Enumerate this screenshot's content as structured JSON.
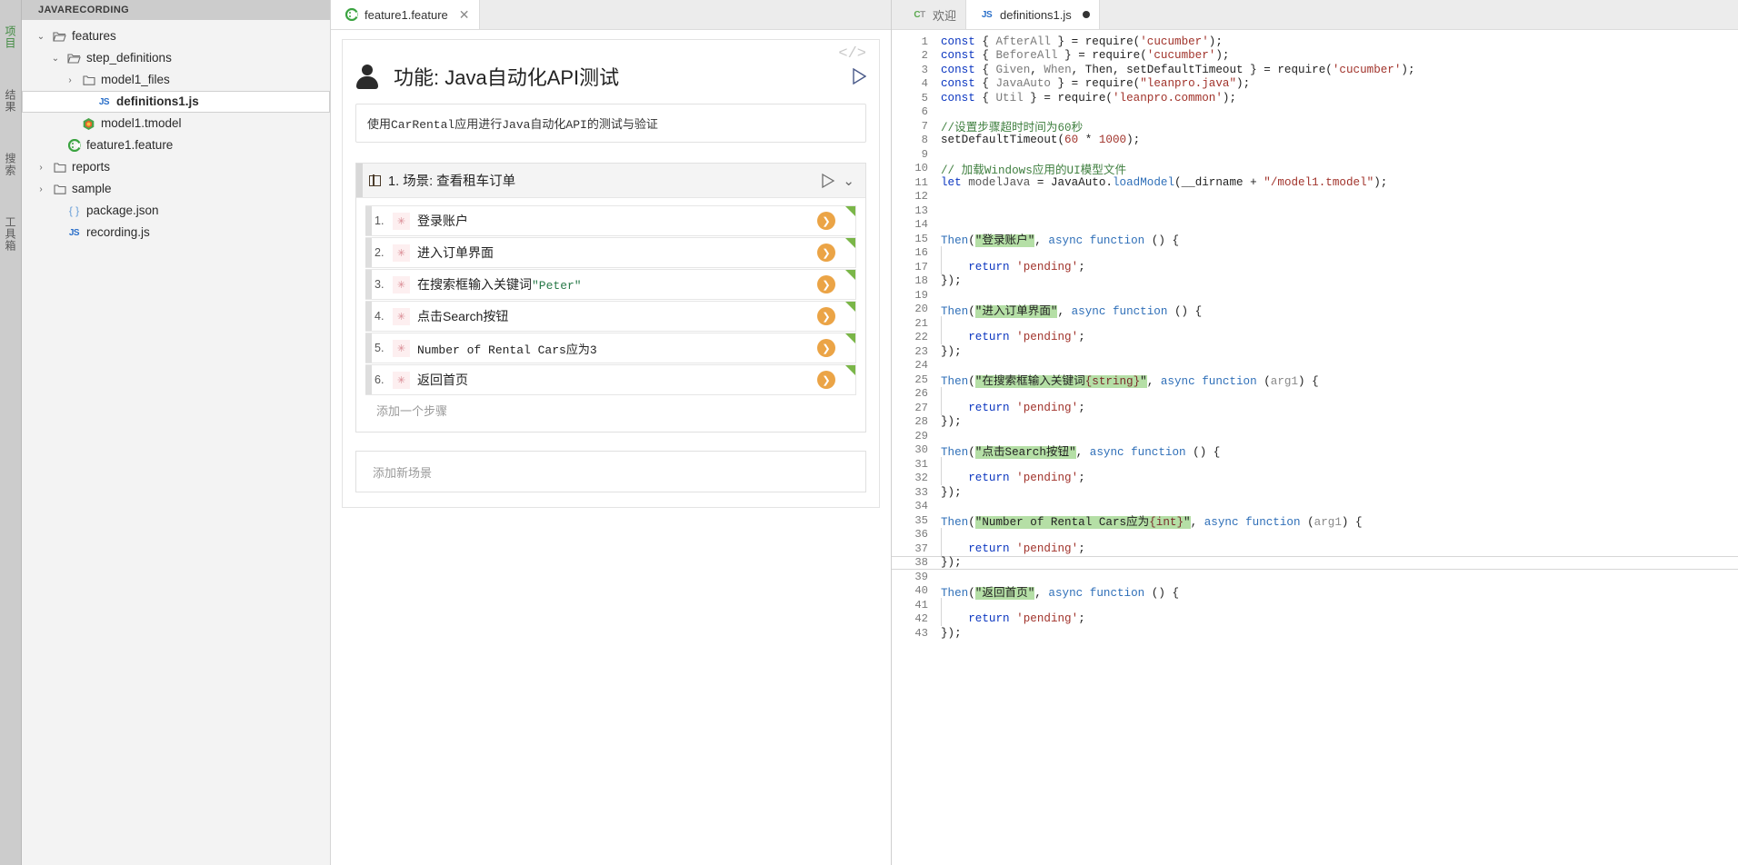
{
  "activitybar": {
    "items": [
      {
        "label": "项目",
        "name": "project",
        "active": true
      },
      {
        "label": "结果",
        "name": "results",
        "active": false
      },
      {
        "label": "搜索",
        "name": "search",
        "active": false
      },
      {
        "label": "工具箱",
        "name": "toolbox",
        "active": false
      }
    ]
  },
  "explorer": {
    "title": "JAVARECORDING",
    "tree": [
      {
        "label": "features",
        "icon": "folder-open-icon",
        "chevron": "⌄",
        "indent": 0,
        "selected": false
      },
      {
        "label": "step_definitions",
        "icon": "folder-open-icon",
        "chevron": "⌄",
        "indent": 1,
        "selected": false
      },
      {
        "label": "model1_files",
        "icon": "folder-icon",
        "chevron": "›",
        "indent": 2,
        "selected": false
      },
      {
        "label": "definitions1.js",
        "icon": "js-icon",
        "chevron": "",
        "indent": 3,
        "selected": true
      },
      {
        "label": "model1.tmodel",
        "icon": "tmodel-icon",
        "chevron": "",
        "indent": 2,
        "selected": false
      },
      {
        "label": "feature1.feature",
        "icon": "cucumber-icon",
        "chevron": "",
        "indent": 1,
        "selected": false
      },
      {
        "label": "reports",
        "icon": "folder-icon",
        "chevron": "›",
        "indent": 0,
        "selected": false
      },
      {
        "label": "sample",
        "icon": "folder-icon",
        "chevron": "›",
        "indent": 0,
        "selected": false
      },
      {
        "label": "package.json",
        "icon": "json-icon",
        "chevron": "",
        "indent": 1,
        "selected": false
      },
      {
        "label": "recording.js",
        "icon": "js-icon",
        "chevron": "",
        "indent": 1,
        "selected": false
      }
    ]
  },
  "center": {
    "tabs": [
      {
        "label": "feature1.feature",
        "icon": "cucumber-icon",
        "active": true,
        "close": "✕"
      }
    ],
    "code_toggle": "</>",
    "feature_title": "功能: Java自动化API测试",
    "feature_description": "使用CarRental应用进行Java自动化API的测试与验证",
    "scenario": {
      "title": "1. 场景: 查看租车订单",
      "collapse_icon": "⌄",
      "steps": [
        {
          "num": "1.",
          "star": "✳",
          "text": "登录账户",
          "suffix": "",
          "suffix_kind": ""
        },
        {
          "num": "2.",
          "star": "✳",
          "text": "进入订单界面",
          "suffix": "",
          "suffix_kind": ""
        },
        {
          "num": "3.",
          "star": "✳",
          "text": "在搜索框输入关键词",
          "suffix": "\"Peter\"",
          "suffix_kind": "quoted"
        },
        {
          "num": "4.",
          "star": "✳",
          "text": "点击Search按钮",
          "suffix": "",
          "suffix_kind": ""
        },
        {
          "num": "5.",
          "star": "✳",
          "text": "Number of Rental Cars应为3",
          "suffix": "",
          "suffix_kind": "mono"
        },
        {
          "num": "6.",
          "star": "✳",
          "text": "返回首页",
          "suffix": "",
          "suffix_kind": ""
        }
      ],
      "play_glyph": "❯"
    },
    "add_step_label": "添加一个步骤",
    "add_scenario_label": "添加新场景"
  },
  "right": {
    "tabs": [
      {
        "label": "欢迎",
        "icon": "ct-icon",
        "active": false,
        "dirty": false
      },
      {
        "label": "definitions1.js",
        "icon": "js-icon",
        "active": true,
        "dirty": true
      }
    ],
    "code": [
      {
        "n": 1,
        "tokens": [
          {
            "t": "const ",
            "c": "kw"
          },
          {
            "t": "{ ",
            "c": "tok"
          },
          {
            "t": "AfterAll",
            "c": "kwp"
          },
          {
            "t": " } = ",
            "c": "tok"
          },
          {
            "t": "require",
            "c": "tok"
          },
          {
            "t": "(",
            "c": "tok"
          },
          {
            "t": "'cucumber'",
            "c": "str"
          },
          {
            "t": ");",
            "c": "tok"
          }
        ]
      },
      {
        "n": 2,
        "tokens": [
          {
            "t": "const ",
            "c": "kw"
          },
          {
            "t": "{ ",
            "c": "tok"
          },
          {
            "t": "BeforeAll",
            "c": "kwp"
          },
          {
            "t": " } = ",
            "c": "tok"
          },
          {
            "t": "require",
            "c": "tok"
          },
          {
            "t": "(",
            "c": "tok"
          },
          {
            "t": "'cucumber'",
            "c": "str"
          },
          {
            "t": ");",
            "c": "tok"
          }
        ]
      },
      {
        "n": 3,
        "tokens": [
          {
            "t": "const ",
            "c": "kw"
          },
          {
            "t": "{ ",
            "c": "tok"
          },
          {
            "t": "Given",
            "c": "kwp"
          },
          {
            "t": ", ",
            "c": "tok"
          },
          {
            "t": "When",
            "c": "kwp"
          },
          {
            "t": ", Then, setDefaultTimeout } = ",
            "c": "tok"
          },
          {
            "t": "require",
            "c": "tok"
          },
          {
            "t": "(",
            "c": "tok"
          },
          {
            "t": "'cucumber'",
            "c": "str"
          },
          {
            "t": ");",
            "c": "tok"
          }
        ]
      },
      {
        "n": 4,
        "tokens": [
          {
            "t": "const ",
            "c": "kw"
          },
          {
            "t": "{ ",
            "c": "tok"
          },
          {
            "t": "JavaAuto",
            "c": "kwp"
          },
          {
            "t": " } = ",
            "c": "tok"
          },
          {
            "t": "require",
            "c": "tok"
          },
          {
            "t": "(",
            "c": "tok"
          },
          {
            "t": "\"leanpro.java\"",
            "c": "str"
          },
          {
            "t": ");",
            "c": "tok"
          }
        ]
      },
      {
        "n": 5,
        "tokens": [
          {
            "t": "const ",
            "c": "kw"
          },
          {
            "t": "{ ",
            "c": "tok"
          },
          {
            "t": "Util",
            "c": "kwp"
          },
          {
            "t": " } = ",
            "c": "tok"
          },
          {
            "t": "require",
            "c": "tok"
          },
          {
            "t": "(",
            "c": "tok"
          },
          {
            "t": "'leanpro.common'",
            "c": "str"
          },
          {
            "t": ");",
            "c": "tok"
          }
        ]
      },
      {
        "n": 6,
        "tokens": []
      },
      {
        "n": 7,
        "tokens": [
          {
            "t": "//设置步骤超时时间为60秒",
            "c": "cmt"
          }
        ]
      },
      {
        "n": 8,
        "tokens": [
          {
            "t": "setDefaultTimeout(",
            "c": "tok"
          },
          {
            "t": "60",
            "c": "str"
          },
          {
            "t": " * ",
            "c": "tok"
          },
          {
            "t": "1000",
            "c": "str"
          },
          {
            "t": ");",
            "c": "tok"
          }
        ]
      },
      {
        "n": 9,
        "tokens": []
      },
      {
        "n": 10,
        "tokens": [
          {
            "t": "// 加载Windows应用的UI模型文件",
            "c": "cmt"
          }
        ]
      },
      {
        "n": 11,
        "tokens": [
          {
            "t": "let ",
            "c": "kw"
          },
          {
            "t": "modelJava",
            "c": "id"
          },
          {
            "t": " = ",
            "c": "tok"
          },
          {
            "t": "JavaAuto",
            "c": "tok"
          },
          {
            "t": ".",
            "c": "tok"
          },
          {
            "t": "loadModel",
            "c": "fn"
          },
          {
            "t": "(__dirname + ",
            "c": "tok"
          },
          {
            "t": "\"/model1.tmodel\"",
            "c": "str"
          },
          {
            "t": ");",
            "c": "tok"
          }
        ]
      },
      {
        "n": 12,
        "tokens": []
      },
      {
        "n": 13,
        "tokens": []
      },
      {
        "n": 14,
        "tokens": []
      },
      {
        "n": 15,
        "tokens": [
          {
            "t": "Then",
            "c": "fn"
          },
          {
            "t": "(",
            "c": "tok"
          },
          {
            "t": "\"登录账户\"",
            "c": "hl"
          },
          {
            "t": ", ",
            "c": "tok"
          },
          {
            "t": "async function",
            "c": "fn"
          },
          {
            "t": " () {",
            "c": "tok"
          }
        ]
      },
      {
        "n": 16,
        "tokens": [],
        "guide": true
      },
      {
        "n": 17,
        "tokens": [
          {
            "t": "    ",
            "c": "tok"
          },
          {
            "t": "return",
            "c": "kw"
          },
          {
            "t": " ",
            "c": "tok"
          },
          {
            "t": "'pending'",
            "c": "str"
          },
          {
            "t": ";",
            "c": "tok"
          }
        ],
        "guide": true
      },
      {
        "n": 18,
        "tokens": [
          {
            "t": "});",
            "c": "tok"
          }
        ]
      },
      {
        "n": 19,
        "tokens": []
      },
      {
        "n": 20,
        "tokens": [
          {
            "t": "Then",
            "c": "fn"
          },
          {
            "t": "(",
            "c": "tok"
          },
          {
            "t": "\"进入订单界面\"",
            "c": "hl"
          },
          {
            "t": ", ",
            "c": "tok"
          },
          {
            "t": "async function",
            "c": "fn"
          },
          {
            "t": " () {",
            "c": "tok"
          }
        ]
      },
      {
        "n": 21,
        "tokens": [],
        "guide": true
      },
      {
        "n": 22,
        "tokens": [
          {
            "t": "    ",
            "c": "tok"
          },
          {
            "t": "return",
            "c": "kw"
          },
          {
            "t": " ",
            "c": "tok"
          },
          {
            "t": "'pending'",
            "c": "str"
          },
          {
            "t": ";",
            "c": "tok"
          }
        ],
        "guide": true
      },
      {
        "n": 23,
        "tokens": [
          {
            "t": "});",
            "c": "tok"
          }
        ]
      },
      {
        "n": 24,
        "tokens": []
      },
      {
        "n": 25,
        "tokens": [
          {
            "t": "Then",
            "c": "fn"
          },
          {
            "t": "(",
            "c": "tok"
          },
          {
            "t": "\"在搜索框输入关键词",
            "c": "hl"
          },
          {
            "t": "{string}",
            "c": "hlp"
          },
          {
            "t": "\"",
            "c": "hl"
          },
          {
            "t": ", ",
            "c": "tok"
          },
          {
            "t": "async function",
            "c": "fn"
          },
          {
            "t": " (",
            "c": "tok"
          },
          {
            "t": "arg1",
            "c": "arg"
          },
          {
            "t": ") {",
            "c": "tok"
          }
        ]
      },
      {
        "n": 26,
        "tokens": [],
        "guide": true
      },
      {
        "n": 27,
        "tokens": [
          {
            "t": "    ",
            "c": "tok"
          },
          {
            "t": "return",
            "c": "kw"
          },
          {
            "t": " ",
            "c": "tok"
          },
          {
            "t": "'pending'",
            "c": "str"
          },
          {
            "t": ";",
            "c": "tok"
          }
        ],
        "guide": true
      },
      {
        "n": 28,
        "tokens": [
          {
            "t": "});",
            "c": "tok"
          }
        ]
      },
      {
        "n": 29,
        "tokens": []
      },
      {
        "n": 30,
        "tokens": [
          {
            "t": "Then",
            "c": "fn"
          },
          {
            "t": "(",
            "c": "tok"
          },
          {
            "t": "\"点击Search按钮\"",
            "c": "hl"
          },
          {
            "t": ", ",
            "c": "tok"
          },
          {
            "t": "async function",
            "c": "fn"
          },
          {
            "t": " () {",
            "c": "tok"
          }
        ]
      },
      {
        "n": 31,
        "tokens": [],
        "guide": true
      },
      {
        "n": 32,
        "tokens": [
          {
            "t": "    ",
            "c": "tok"
          },
          {
            "t": "return",
            "c": "kw"
          },
          {
            "t": " ",
            "c": "tok"
          },
          {
            "t": "'pending'",
            "c": "str"
          },
          {
            "t": ";",
            "c": "tok"
          }
        ],
        "guide": true
      },
      {
        "n": 33,
        "tokens": [
          {
            "t": "});",
            "c": "tok"
          }
        ]
      },
      {
        "n": 34,
        "tokens": []
      },
      {
        "n": 35,
        "tokens": [
          {
            "t": "Then",
            "c": "fn"
          },
          {
            "t": "(",
            "c": "tok"
          },
          {
            "t": "\"Number of Rental Cars应为",
            "c": "hl"
          },
          {
            "t": "{int}",
            "c": "hlp"
          },
          {
            "t": "\"",
            "c": "hl"
          },
          {
            "t": ", ",
            "c": "tok"
          },
          {
            "t": "async function",
            "c": "fn"
          },
          {
            "t": " (",
            "c": "tok"
          },
          {
            "t": "arg1",
            "c": "arg"
          },
          {
            "t": ") {",
            "c": "tok"
          }
        ]
      },
      {
        "n": 36,
        "tokens": [],
        "guide": true
      },
      {
        "n": 37,
        "tokens": [
          {
            "t": "    ",
            "c": "tok"
          },
          {
            "t": "return",
            "c": "kw"
          },
          {
            "t": " ",
            "c": "tok"
          },
          {
            "t": "'pending'",
            "c": "str"
          },
          {
            "t": ";",
            "c": "tok"
          }
        ],
        "guide": true
      },
      {
        "n": 38,
        "tokens": [
          {
            "t": "});",
            "c": "tok"
          }
        ],
        "cursor": true
      },
      {
        "n": 39,
        "tokens": []
      },
      {
        "n": 40,
        "tokens": [
          {
            "t": "Then",
            "c": "fn"
          },
          {
            "t": "(",
            "c": "tok"
          },
          {
            "t": "\"返回首页\"",
            "c": "hl"
          },
          {
            "t": ", ",
            "c": "tok"
          },
          {
            "t": "async function",
            "c": "fn"
          },
          {
            "t": " () {",
            "c": "tok"
          }
        ]
      },
      {
        "n": 41,
        "tokens": [],
        "guide": true
      },
      {
        "n": 42,
        "tokens": [
          {
            "t": "    ",
            "c": "tok"
          },
          {
            "t": "return",
            "c": "kw"
          },
          {
            "t": " ",
            "c": "tok"
          },
          {
            "t": "'pending'",
            "c": "str"
          },
          {
            "t": ";",
            "c": "tok"
          }
        ],
        "guide": true
      },
      {
        "n": 43,
        "tokens": [
          {
            "t": "});",
            "c": "tok"
          }
        ]
      }
    ]
  },
  "colors": {
    "accent_orange": "#eba446",
    "accent_green": "#7ab648",
    "highlight_green": "#b5dfa6",
    "activity_active": "#5aa84f"
  }
}
